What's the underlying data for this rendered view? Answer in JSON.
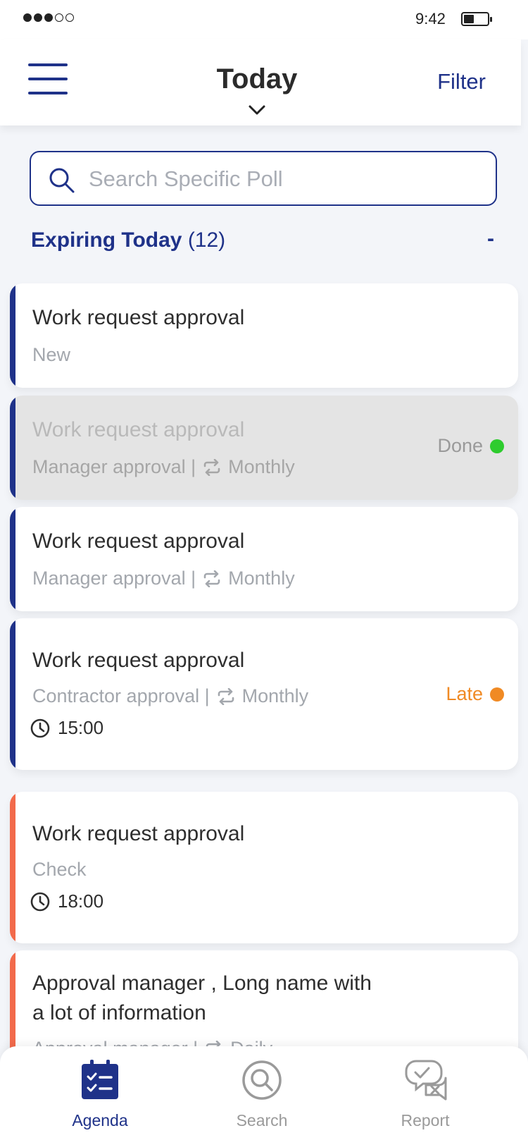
{
  "status_bar": {
    "time": "9:42"
  },
  "header": {
    "title": "Today",
    "filter_label": "Filter"
  },
  "search": {
    "placeholder": "Search Specific Poll",
    "value": ""
  },
  "section": {
    "title": "Expiring Today",
    "count": "(12)",
    "collapse_label": "-"
  },
  "colors": {
    "accent": "#1f3289",
    "late": "#f08a24",
    "done": "#2ecc2e",
    "urgent_bar": "#f26a4b"
  },
  "cards": [
    {
      "title": "Work request approval",
      "subtitle": "New"
    },
    {
      "title": "Work request approval",
      "subtitle": "Manager approval |",
      "recurrence": "Monthly",
      "status": "Done"
    },
    {
      "title": "Work request approval",
      "subtitle": "Manager approval |",
      "recurrence": "Monthly"
    },
    {
      "title": "Work request approval",
      "subtitle": "Contractor approval |",
      "recurrence": "Monthly",
      "time": "15:00",
      "status": "Late"
    },
    {
      "title": "Work request approval",
      "subtitle": "Check",
      "time": "18:00"
    },
    {
      "title_line1": "Approval manager , Long name with",
      "title_line2": "a lot of information",
      "subtitle": "Approval manager |",
      "recurrence": "Daily"
    }
  ],
  "tabs": [
    {
      "label": "Agenda",
      "icon": "agenda-icon",
      "active": true
    },
    {
      "label": "Search",
      "icon": "search-icon",
      "active": false
    },
    {
      "label": "Report",
      "icon": "report-icon",
      "active": false
    }
  ]
}
